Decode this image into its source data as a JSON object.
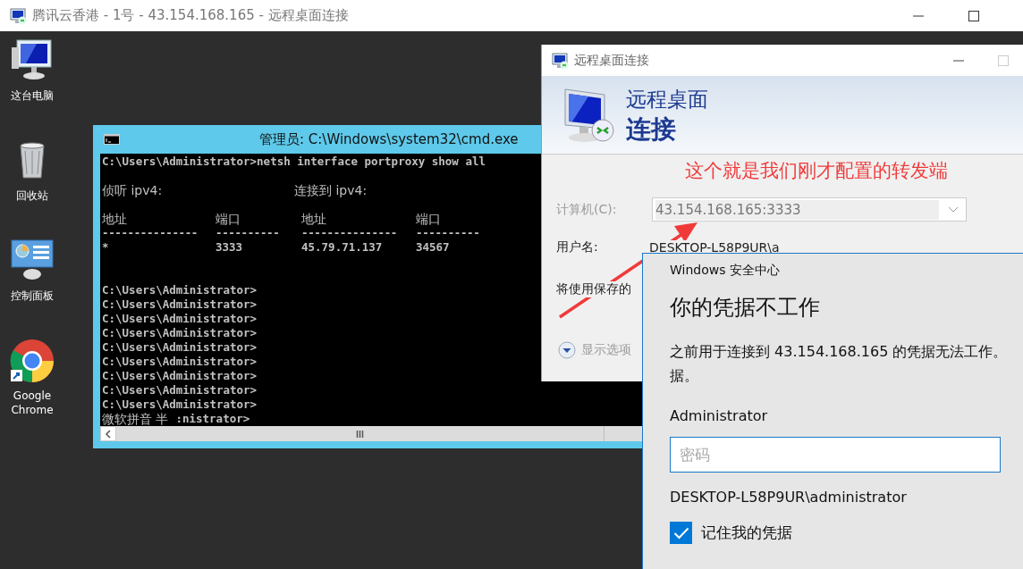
{
  "window": {
    "title": "腾讯云香港 - 1号 - 43.154.168.165 - 远程桌面连接"
  },
  "desktop_icons": [
    {
      "kind": "computer",
      "label": "这台电脑"
    },
    {
      "kind": "recycle-bin",
      "label": "回收站"
    },
    {
      "kind": "control-panel",
      "label": "控制面板"
    },
    {
      "kind": "chrome",
      "label": "Google Chrome"
    }
  ],
  "cmd_window": {
    "title": "管理员: C:\\Windows\\system32\\cmd.exe",
    "command_line": "C:\\Users\\Administrator>netsh interface portproxy show all",
    "listen_header": "侦听 ipv4:",
    "connect_header": "连接到 ipv4:",
    "columns": [
      "地址",
      "端口",
      "地址",
      "端口"
    ],
    "rules": [
      "---------------",
      "----------",
      "---------------",
      "----------"
    ],
    "rows": [
      [
        "*",
        "3333",
        "45.79.71.137",
        "34567"
      ]
    ],
    "prompts": [
      "C:\\Users\\Administrator>",
      "C:\\Users\\Administrator>",
      "C:\\Users\\Administrator>",
      "C:\\Users\\Administrator>",
      "C:\\Users\\Administrator>",
      "C:\\Users\\Administrator>",
      "C:\\Users\\Administrator>",
      "C:\\Users\\Administrator>",
      "C:\\Users\\Administrator>"
    ],
    "ime_status": "微软拼音 半",
    "ime_line_rest": ":nistrator>"
  },
  "rdp_dialog": {
    "title": "远程桌面连接",
    "banner_line1": "远程桌面",
    "banner_line2": "连接",
    "computer_label": "计算机(C):",
    "computer_value": "43.154.168.165:3333",
    "username_label": "用户名:",
    "username_value": "DESKTOP-L58P9UR\\a",
    "saved_note": "将使用保存的",
    "options_link": "显示选项"
  },
  "annotation": {
    "text": "这个就是我们刚才配置的转发端"
  },
  "security_dialog": {
    "header": "Windows 安全中心",
    "title": "你的凭据不工作",
    "message_line1": "之前用于连接到 43.154.168.165 的凭据无法工作。",
    "message_line2": "据。",
    "user": "Administrator",
    "password": {
      "placeholder": "密码"
    },
    "account": "DESKTOP-L58P9UR\\administrator",
    "remember": {
      "label": "记住我的凭据",
      "checked": true
    }
  }
}
